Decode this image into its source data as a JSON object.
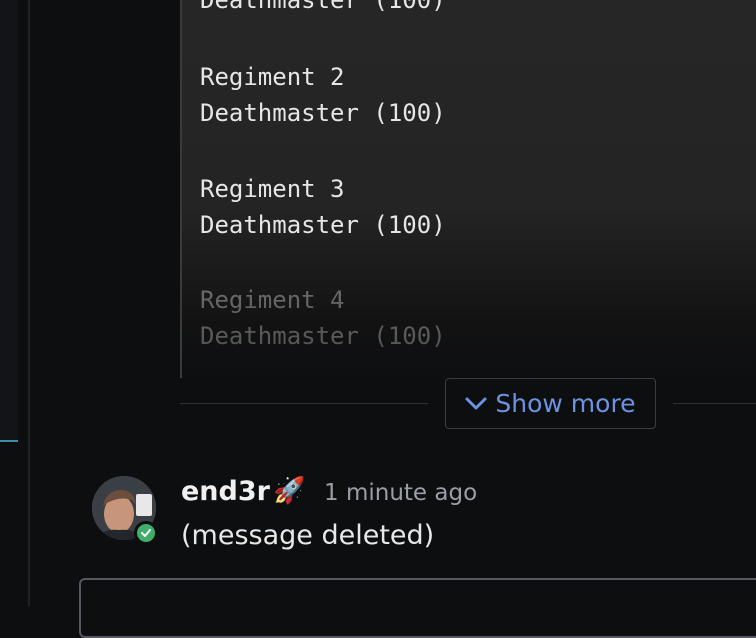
{
  "code_block": {
    "lines": [
      {
        "text": "Deathmaster (100)",
        "faded": false
      },
      {
        "text": "Regiment 2",
        "faded": false
      },
      {
        "text": "Deathmaster (100)",
        "faded": false
      },
      {
        "text": "Regiment 3",
        "faded": false
      },
      {
        "text": "Deathmaster (100)",
        "faded": false
      },
      {
        "text": "Regiment 4",
        "faded": true
      },
      {
        "text": "Deathmaster (100)",
        "faded": true
      }
    ]
  },
  "show_more": {
    "label": "Show more",
    "icon": "chevron-down-icon",
    "color": "#6d93e0"
  },
  "message": {
    "username": "end3r",
    "badge_icon": "rocket-icon",
    "badge_glyph": "🚀",
    "timestamp": "1 minute ago",
    "text": "(message deleted)",
    "status": "online",
    "status_color": "#3fae6a"
  }
}
